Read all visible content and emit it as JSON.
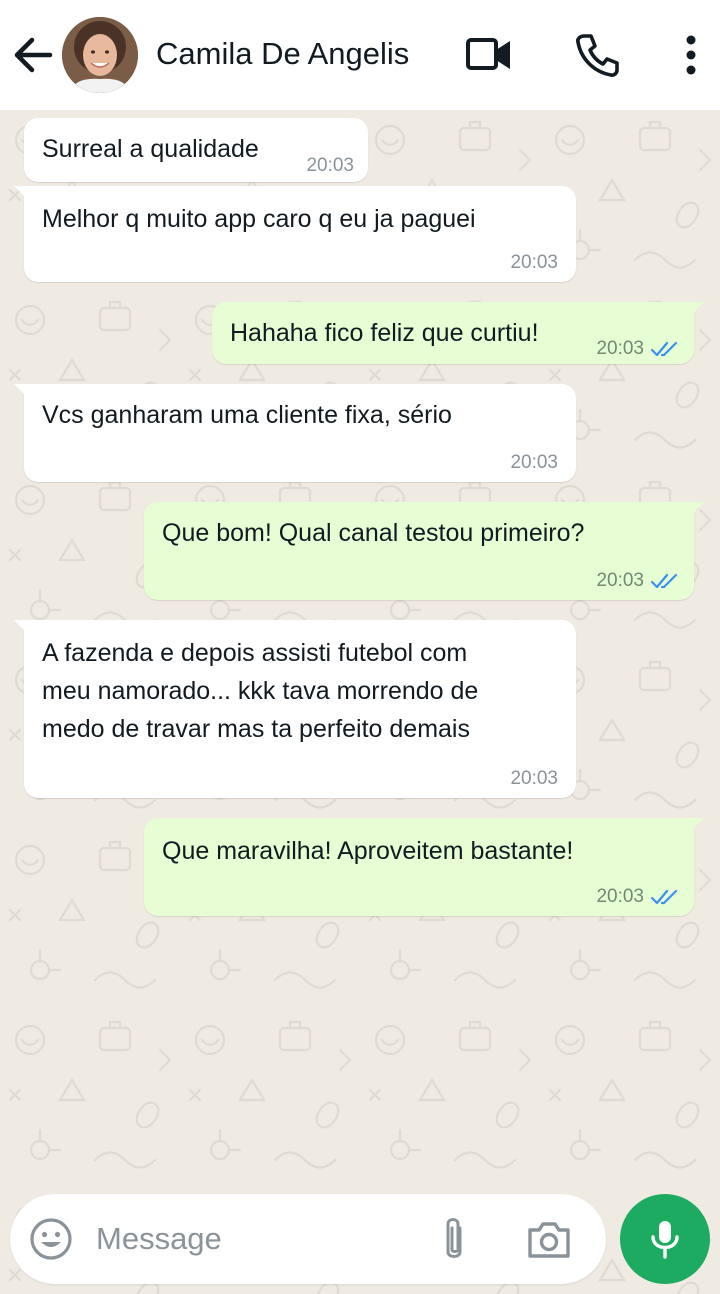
{
  "header": {
    "contact_name": "Camila De Angelis",
    "back_icon": "arrow-left-icon",
    "video_icon": "video-camera-icon",
    "call_icon": "phone-icon",
    "menu_icon": "more-vertical-icon"
  },
  "messages": [
    {
      "direction": "in",
      "text": "Surreal a qualidade",
      "time": "20:03"
    },
    {
      "direction": "in",
      "text": "Melhor q muito app caro q eu ja paguei",
      "time": "20:03"
    },
    {
      "direction": "out",
      "text": "Hahaha fico feliz que curtiu!",
      "time": "20:03",
      "status": "read"
    },
    {
      "direction": "in",
      "text": "Vcs ganharam uma cliente fixa, sério",
      "time": "20:03"
    },
    {
      "direction": "out",
      "text": "Que bom! Qual canal testou primeiro?",
      "time": "20:03",
      "status": "read"
    },
    {
      "direction": "in",
      "text": "A fazenda e depois assisti futebol com\nmeu namorado... kkk tava morrendo de\nmedo de travar mas ta perfeito demais",
      "time": "20:03"
    },
    {
      "direction": "out",
      "text": "Que maravilha! Aproveitem bastante!",
      "time": "20:03",
      "status": "read"
    }
  ],
  "composer": {
    "placeholder": "Message",
    "value": ""
  },
  "colors": {
    "chat_background": "#efeae2",
    "incoming_bubble": "#ffffff",
    "outgoing_bubble": "#e7fed5",
    "read_ticks": "#3b8ff3",
    "mic_button": "#1daa61"
  }
}
